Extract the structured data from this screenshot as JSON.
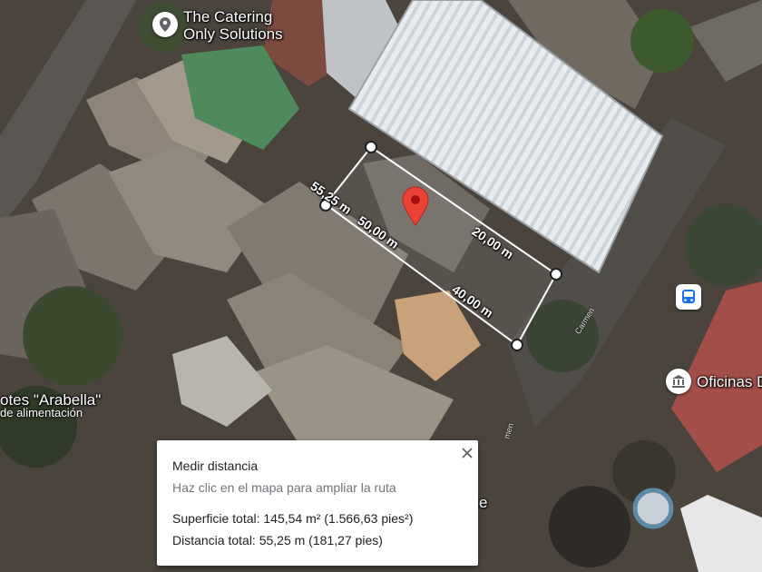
{
  "map": {
    "places": [
      {
        "name": "The Catering",
        "name2": "Only Solutions",
        "icon": "place-pin-icon"
      },
      {
        "name": "otes \"Arabella\"",
        "subtitle": "de alimentación"
      },
      {
        "name": "Oficinas D",
        "icon": "government-building-icon"
      }
    ],
    "transit_icon": "bus-stop-icon",
    "partial_label": "e",
    "streets": [
      "Carmen",
      "men"
    ],
    "measure": {
      "segments": [
        "55,25 m",
        "50,00 m",
        "20,00 m",
        "40,00 m"
      ],
      "line_color": "#ffffff",
      "fill_color": "rgba(255,255,255,0.08)"
    },
    "pin_color": "#ea4335"
  },
  "panel": {
    "title": "Medir distancia",
    "hint": "Haz clic en el mapa para ampliar la ruta",
    "area": "Superficie total: 145,54 m² (1.566,63 pies²)",
    "distance": "Distancia total: 55,25 m (181,27 pies)",
    "close_icon": "close-icon"
  }
}
